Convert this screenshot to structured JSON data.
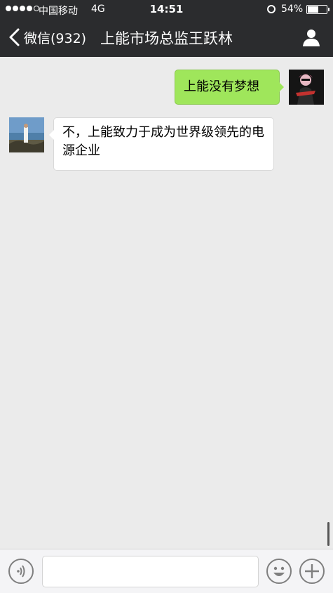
{
  "status_bar": {
    "carrier": "中国移动",
    "network": "4G",
    "time": "14:51",
    "battery": "54%",
    "signal_bars": 4,
    "battery_level": 0.54,
    "icons": [
      "signal-dots-icon",
      "alarm-icon",
      "battery-icon"
    ]
  },
  "nav": {
    "back_label": "微信(932)",
    "title": "上能市场总监王跃林",
    "icons": [
      "back-chevron-icon",
      "profile-icon"
    ]
  },
  "messages": [
    {
      "sender": "me",
      "text": "上能没有梦想"
    },
    {
      "sender": "other",
      "text": "不，上能致力于成为世界级领先的电源企业"
    }
  ],
  "input_bar": {
    "placeholder": "",
    "icons": [
      "voice-icon",
      "emoji-icon",
      "plus-icon"
    ]
  },
  "colors": {
    "topbar": "#2b2c2e",
    "chat_background": "#ebebeb",
    "my_bubble": "#9fe65b",
    "other_bubble": "#ffffff"
  }
}
